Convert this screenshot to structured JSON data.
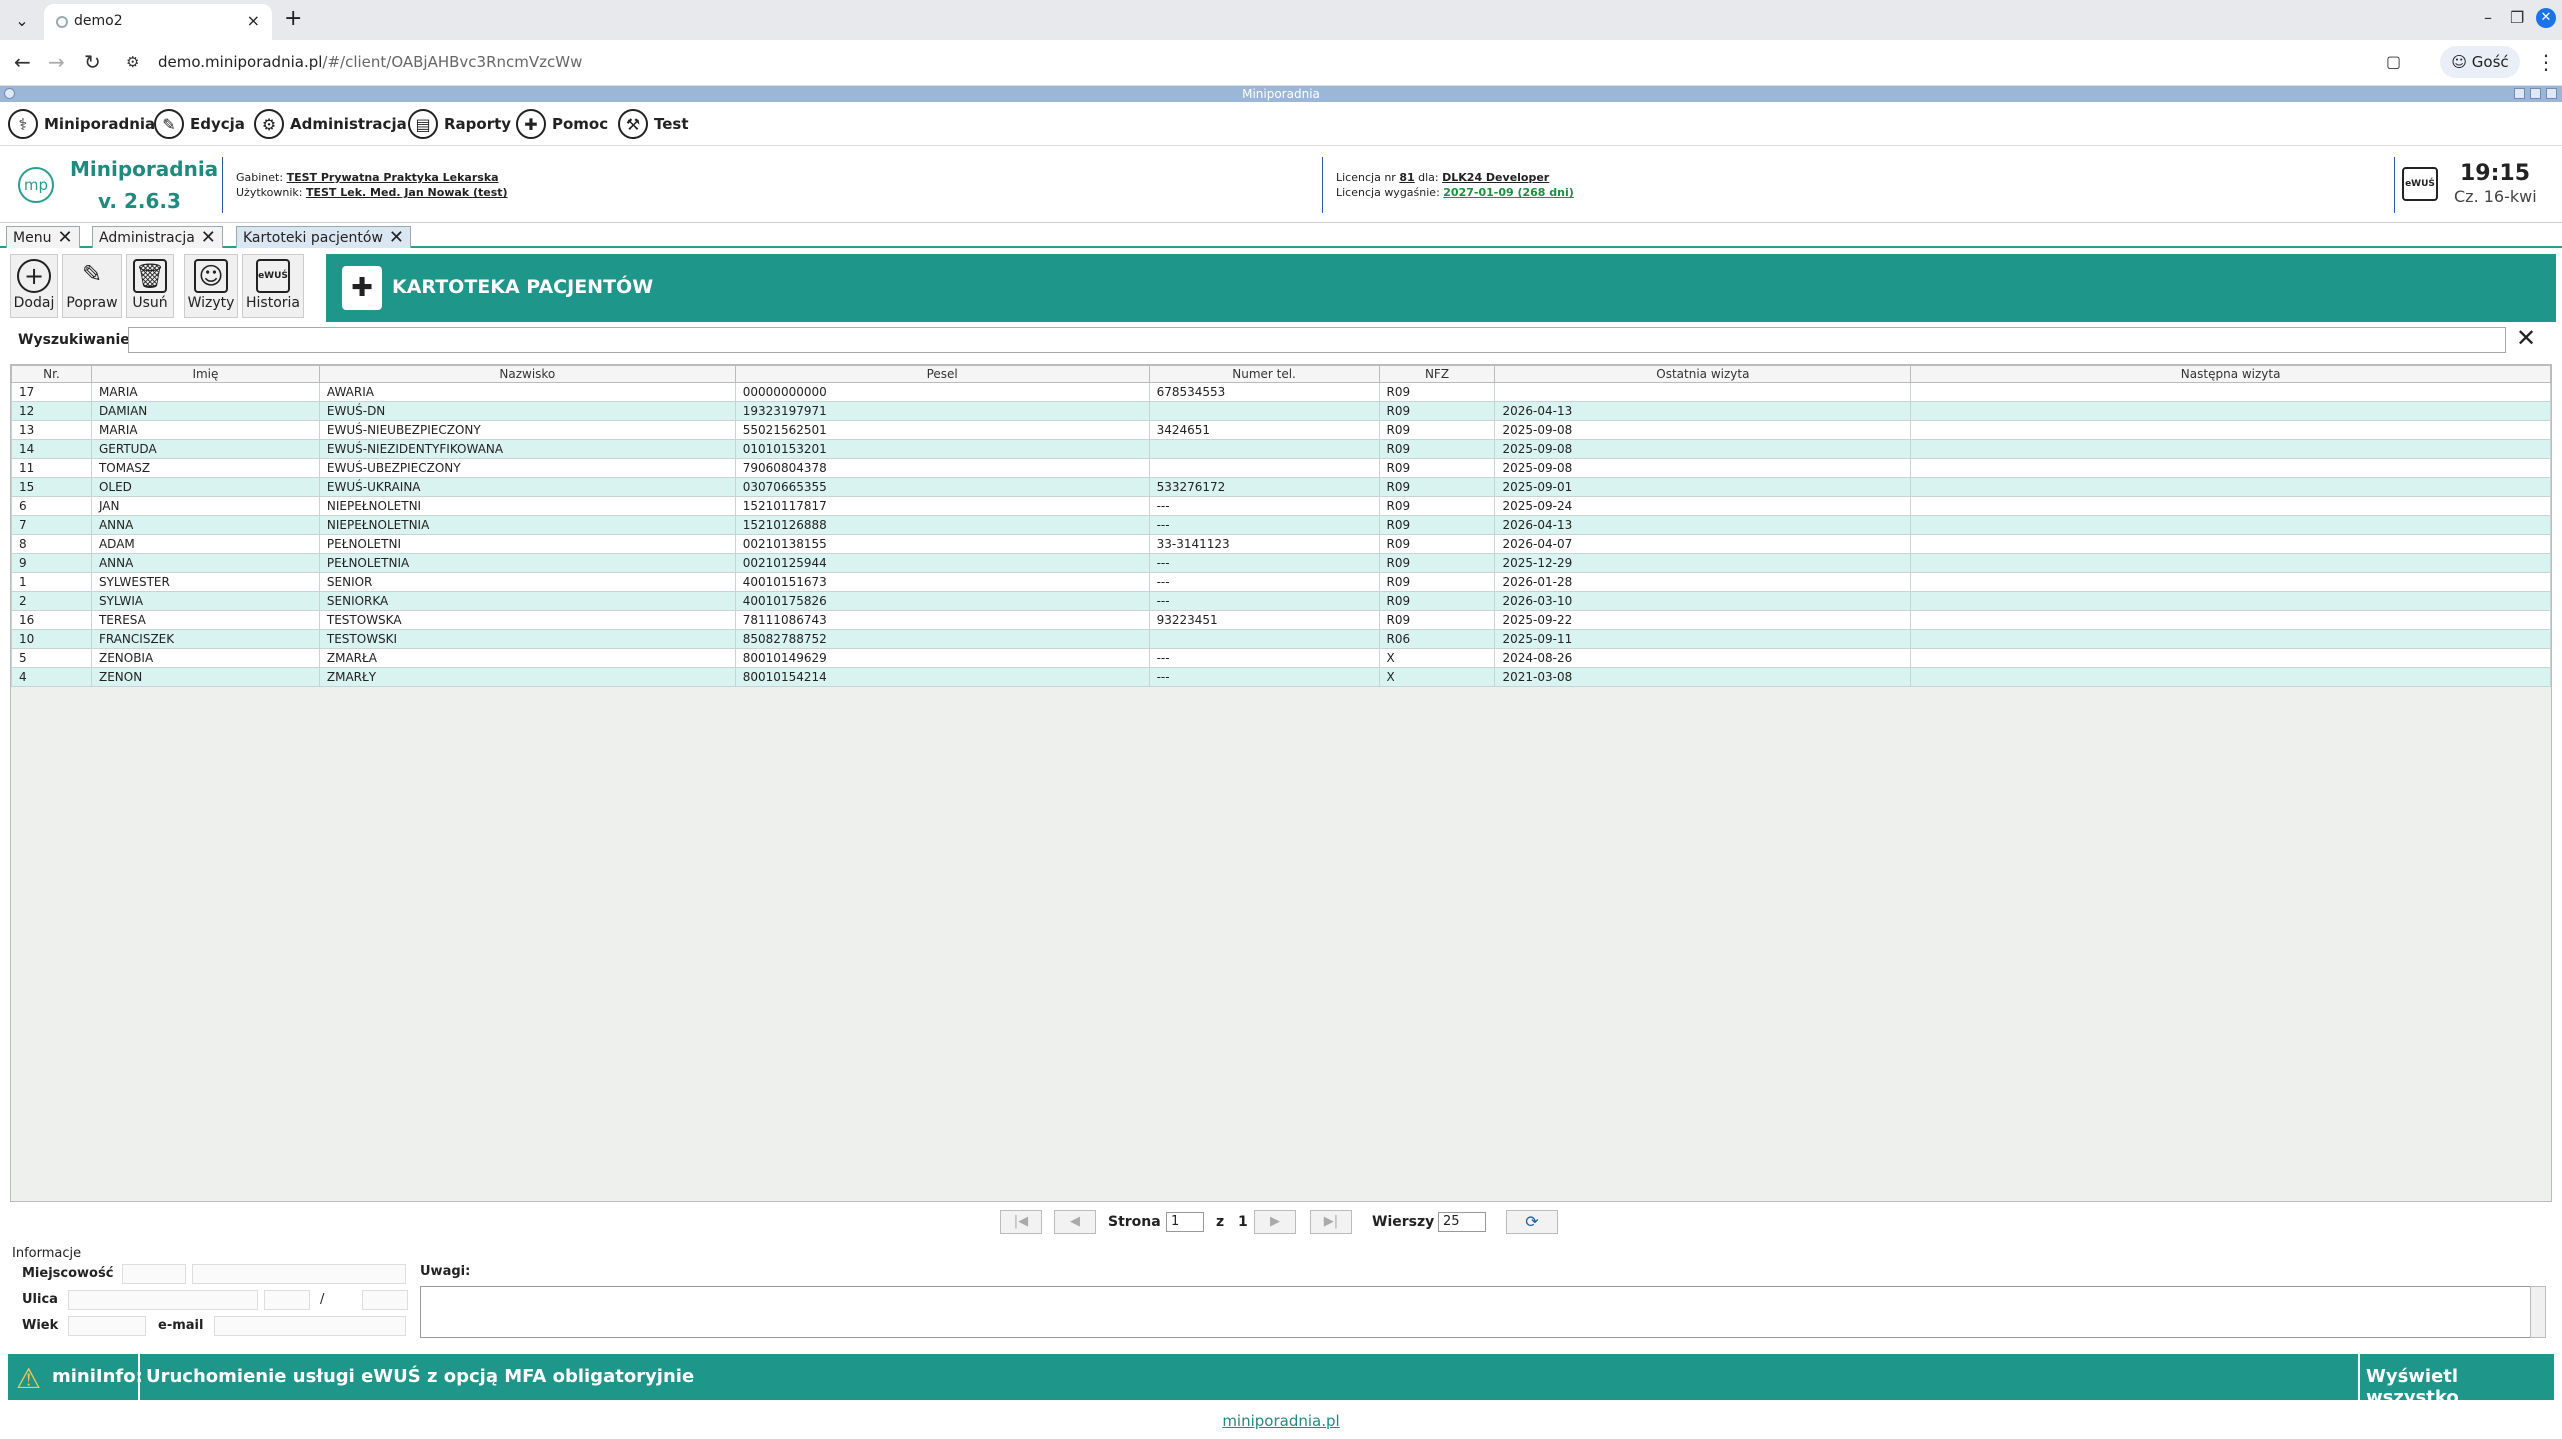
{
  "browser": {
    "tab_title": "demo2",
    "url_host": "demo.miniporadnia.pl",
    "url_path": "/#/client/OABjAHBvc3RncmVzcWw",
    "profile": "Gość"
  },
  "app": {
    "window_title": "Miniporadnia",
    "menu": [
      {
        "label": "Miniporadnia"
      },
      {
        "label": "Edycja"
      },
      {
        "label": "Administracja"
      },
      {
        "label": "Raporty"
      },
      {
        "label": "Pomoc"
      },
      {
        "label": "Test"
      }
    ],
    "name": "Miniporadnia",
    "version": "v. 2.6.3",
    "logo_text": "mp"
  },
  "header": {
    "gabinet_label": "Gabinet:",
    "gabinet_value": "TEST Prywatna Praktyka Lekarska",
    "user_label": "Użytkownik:",
    "user_value": "TEST Lek. Med. Jan Nowak (test)",
    "license_label": "Licencja nr",
    "license_no": "81",
    "license_for": "dla:",
    "license_holder": "DLK24 Developer",
    "expires_label": "Licencja wygaśnie:",
    "expires_value": "2027-01-09 (268 dni)",
    "ewus_badge": "eWUŚ",
    "time": "19:15",
    "date": "Cz. 16-kwi"
  },
  "tabs": [
    {
      "label": "Menu"
    },
    {
      "label": "Administracja"
    },
    {
      "label": "Kartoteki pacjentów"
    }
  ],
  "toolbar": {
    "add": "Dodaj",
    "edit": "Popraw",
    "delete": "Usuń",
    "visits": "Wizyty",
    "history": "Historia",
    "history_badge": "eWUŚ",
    "title": "KARTOTEKA PACJENTÓW"
  },
  "search": {
    "label": "Wyszukiwanie",
    "value": ""
  },
  "table": {
    "columns": [
      "Nr.",
      "Imię",
      "Nazwisko",
      "Pesel",
      "Numer tel.",
      "NFZ",
      "Ostatnia wizyta",
      "Następna wizyta"
    ],
    "rows": [
      [
        "17",
        "MARIA",
        "AWARIA",
        "00000000000",
        "678534553",
        "R09",
        "",
        ""
      ],
      [
        "12",
        "DAMIAN",
        "EWUŚ-DN",
        "19323197971",
        "",
        "R09",
        "2026-04-13",
        ""
      ],
      [
        "13",
        "MARIA",
        "EWUŚ-NIEUBEZPIECZONY",
        "55021562501",
        "3424651",
        "R09",
        "2025-09-08",
        ""
      ],
      [
        "14",
        "GERTUDA",
        "EWUŚ-NIEZIDENTYFIKOWANA",
        "01010153201",
        "",
        "R09",
        "2025-09-08",
        ""
      ],
      [
        "11",
        "TOMASZ",
        "EWUŚ-UBEZPIECZONY",
        "79060804378",
        "",
        "R09",
        "2025-09-08",
        ""
      ],
      [
        "15",
        "OLED",
        "EWUŚ-UKRAINA",
        "03070665355",
        "533276172",
        "R09",
        "2025-09-01",
        ""
      ],
      [
        "6",
        "JAN",
        "NIEPEŁNOLETNI",
        "15210117817",
        "---",
        "R09",
        "2025-09-24",
        ""
      ],
      [
        "7",
        "ANNA",
        "NIEPEŁNOLETNIA",
        "15210126888",
        "---",
        "R09",
        "2026-04-13",
        ""
      ],
      [
        "8",
        "ADAM",
        "PEŁNOLETNI",
        "00210138155",
        "33-3141123",
        "R09",
        "2026-04-07",
        ""
      ],
      [
        "9",
        "ANNA",
        "PEŁNOLETNIA",
        "00210125944",
        "---",
        "R09",
        "2025-12-29",
        ""
      ],
      [
        "1",
        "SYLWESTER",
        "SENIOR",
        "40010151673",
        "---",
        "R09",
        "2026-01-28",
        ""
      ],
      [
        "2",
        "SYLWIA",
        "SENIORKA",
        "40010175826",
        "---",
        "R09",
        "2026-03-10",
        ""
      ],
      [
        "16",
        "TERESA",
        "TESTOWSKA",
        "78111086743",
        "93223451",
        "R09",
        "2025-09-22",
        ""
      ],
      [
        "10",
        "FRANCISZEK",
        "TESTOWSKI",
        "85082788752",
        "",
        "R06",
        "2025-09-11",
        ""
      ],
      [
        "5",
        "ZENOBIA",
        "ZMARŁA",
        "80010149629",
        "---",
        "X",
        "2024-08-26",
        ""
      ],
      [
        "4",
        "ZENON",
        "ZMARŁY",
        "80010154214",
        "---",
        "X",
        "2021-03-08",
        ""
      ]
    ]
  },
  "pager": {
    "page_label": "Strona",
    "page": "1",
    "of_label": "z",
    "total": "1",
    "rows_label": "Wierszy",
    "rows": "25"
  },
  "info": {
    "heading": "Informacje",
    "city_label": "Miejscowość",
    "street_label": "Ulica",
    "slash": "/",
    "age_label": "Wiek",
    "email_label": "e-mail",
    "notes_label": "Uwagi:"
  },
  "footer": {
    "label": "miniInfo:",
    "message": "Uruchomienie usługi eWUŚ z opcją MFA obligatoryjnie",
    "show_all": "Wyświetl wszystko",
    "site": "miniporadnia.pl"
  },
  "colors": {
    "accent": "#1f968a",
    "row_alt": "#d9f3f1",
    "link_green": "#1e8f3a"
  }
}
